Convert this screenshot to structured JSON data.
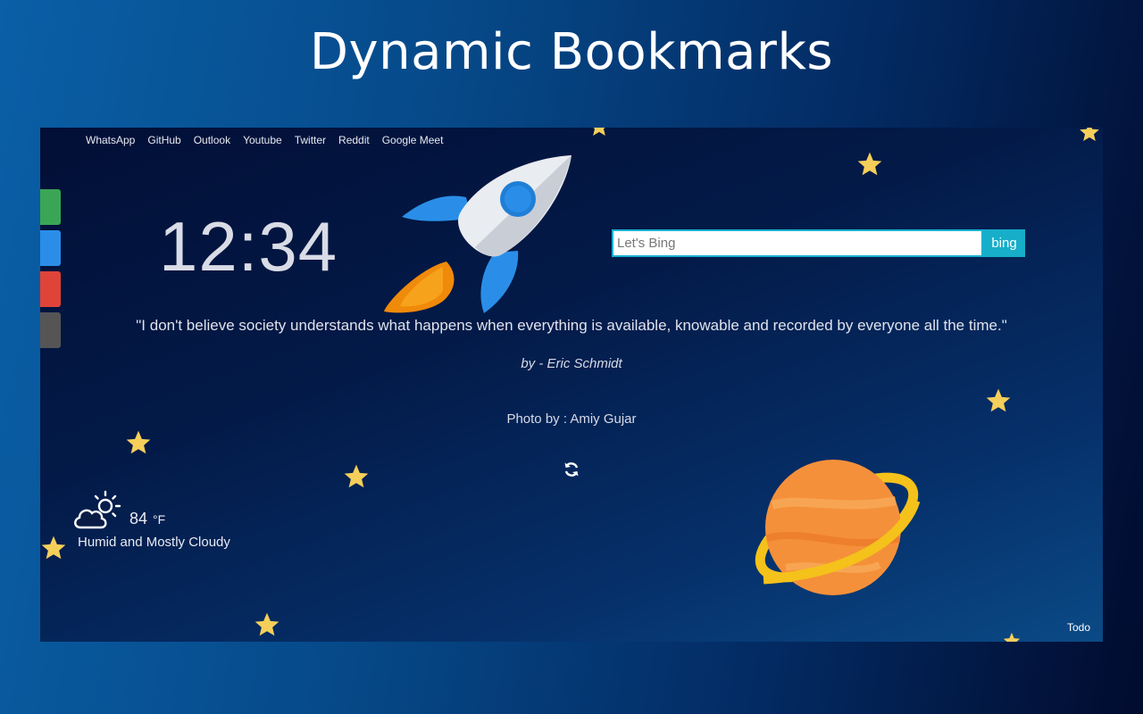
{
  "banner": {
    "title": "Dynamic Bookmarks"
  },
  "topnav": {
    "links": [
      "WhatsApp",
      "GitHub",
      "Outlook",
      "Youtube",
      "Twitter",
      "Reddit",
      "Google Meet"
    ]
  },
  "sidetabs": {
    "colors": [
      "#3aa655",
      "#2a8ee8",
      "#e04438",
      "#555555"
    ]
  },
  "clock": {
    "time": "12:34"
  },
  "search": {
    "placeholder": "Let's Bing",
    "button_label": "bing",
    "accent": "#16aec9"
  },
  "quote": {
    "text": "\"I don't believe society understands what happens when everything is available, knowable and recorded by everyone all the time.\"",
    "author": "by - Eric Schmidt"
  },
  "photo_credit": "Photo by : Amiy Gujar",
  "icons": {
    "refresh": "refresh-icon",
    "weather": "partly-cloudy-icon",
    "rocket": "rocket-illustration",
    "planet": "planet-illustration",
    "star": "star-icon"
  },
  "weather": {
    "temperature": "84",
    "unit": "°F",
    "condition": "Humid and Mostly Cloudy"
  },
  "todo": {
    "label": "Todo"
  }
}
